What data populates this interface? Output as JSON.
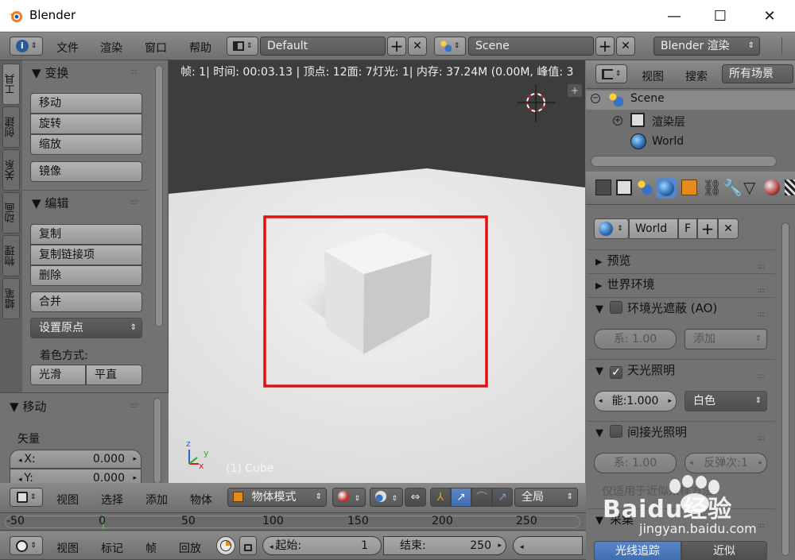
{
  "window": {
    "title": "Blender",
    "min": "—",
    "max": "☐",
    "close": "✕"
  },
  "info_header": {
    "menus": [
      "文件",
      "渲染",
      "窗口",
      "帮助"
    ],
    "layout": "Default",
    "scene": "Scene",
    "engine": "Blender 渲染"
  },
  "toolshelf": {
    "tabs": [
      "工具",
      "创建",
      "关系",
      "动画",
      "物理",
      "蜡笔"
    ],
    "transform_header": "变换",
    "transform_buttons": [
      "移动",
      "旋转",
      "缩放"
    ],
    "mirror": "镜像",
    "edit_header": "编辑",
    "edit_buttons": [
      "复制",
      "复制链接项",
      "删除"
    ],
    "join": "合并",
    "set_origin": "设置原点",
    "shading_label": "着色方式:",
    "smooth": "光滑",
    "flat": "平直",
    "operator_header": "移动",
    "vector_label": "矢量",
    "x_label": "X:",
    "x_value": "0.000",
    "y_label": "Y:",
    "y_value": "0.000"
  },
  "viewport": {
    "stats": "帧: 1| 时间: 00:03.13 | 顶点: 12面: 7灯光: 1| 内存: 37.24M (0.00M, 峰值: 3",
    "object_label": "(1) Cube",
    "axis_x": "x",
    "axis_y": "y",
    "axis_z": "z",
    "highlight_color": "#e01010"
  },
  "view3d_header": {
    "menus": [
      "视图",
      "选择",
      "添加",
      "物体"
    ],
    "mode": "物体模式",
    "orientation": "全局"
  },
  "timeline": {
    "ticks": [
      "-50",
      "0",
      "50",
      "100",
      "150",
      "200",
      "250"
    ],
    "menus": [
      "视图",
      "标记",
      "帧",
      "回放"
    ],
    "start_label": "起始:",
    "start_value": "1",
    "end_label": "结束:",
    "end_value": "250"
  },
  "outliner": {
    "menus": [
      "视图",
      "搜索"
    ],
    "filter": "所有场景",
    "items": [
      "Scene",
      "渲染层",
      "World"
    ]
  },
  "properties": {
    "world_name": "World",
    "fake_user": "F",
    "sections": {
      "preview": "预览",
      "world_env": "世界环境",
      "ao": "环境光遮蔽 (AO)",
      "env_light": "天光照明",
      "indirect": "间接光照明",
      "gather": "采集"
    },
    "ao_factor": "系: 1.00",
    "ao_blend": "添加",
    "env_energy": "能:1.000",
    "env_color": "白色",
    "indirect_factor": "系: 1.00",
    "bounces": "反弹次:1",
    "note": "仅适用于近似采样方法",
    "gather_method_a": "光线追踪",
    "gather_method_b": "近似"
  },
  "watermark": {
    "brand": "Baidu经验",
    "url": "jingyan.baidu.com"
  }
}
